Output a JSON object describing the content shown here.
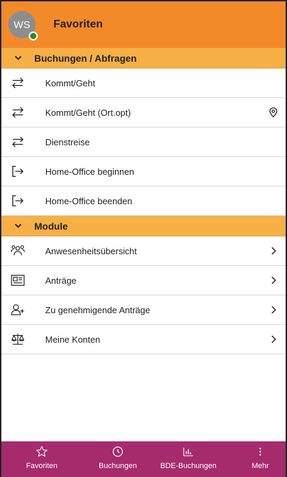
{
  "header": {
    "avatar_initials": "WS",
    "title": "Favoriten",
    "status_color": "#1a8e2b",
    "header_color": "#f38a2a"
  },
  "sections": [
    {
      "label": "Buchungen / Abfragen",
      "items": [
        {
          "label": "Kommt/Geht",
          "icon": "swap-arrows-icon"
        },
        {
          "label": "Kommt/Geht (Ort.opt)",
          "icon": "swap-arrows-icon",
          "right_icon": "location-pin-icon"
        },
        {
          "label": "Dienstreise",
          "icon": "swap-arrows-icon"
        },
        {
          "label": "Home-Office beginnen",
          "icon": "enter-icon"
        },
        {
          "label": "Home-Office beenden",
          "icon": "enter-icon"
        }
      ]
    },
    {
      "label": "Module",
      "items": [
        {
          "label": "Anwesenheitsübersicht",
          "icon": "users-group-icon",
          "right_icon": "chevron-right-icon"
        },
        {
          "label": "Anträge",
          "icon": "form-icon",
          "right_icon": "chevron-right-icon"
        },
        {
          "label": "Zu genehmigende Anträge",
          "icon": "user-add-icon",
          "right_icon": "chevron-right-icon"
        },
        {
          "label": "Meine Konten",
          "icon": "balance-scale-icon",
          "right_icon": "chevron-right-icon"
        }
      ]
    }
  ],
  "nav": {
    "items": [
      {
        "label": "Favoriten",
        "icon": "star-icon"
      },
      {
        "label": "Buchungen",
        "icon": "clock-icon"
      },
      {
        "label": "BDE-Buchungen",
        "icon": "bar-chart-icon"
      },
      {
        "label": "Mehr",
        "icon": "more-vertical-icon"
      }
    ],
    "color": "#a52b6d"
  }
}
